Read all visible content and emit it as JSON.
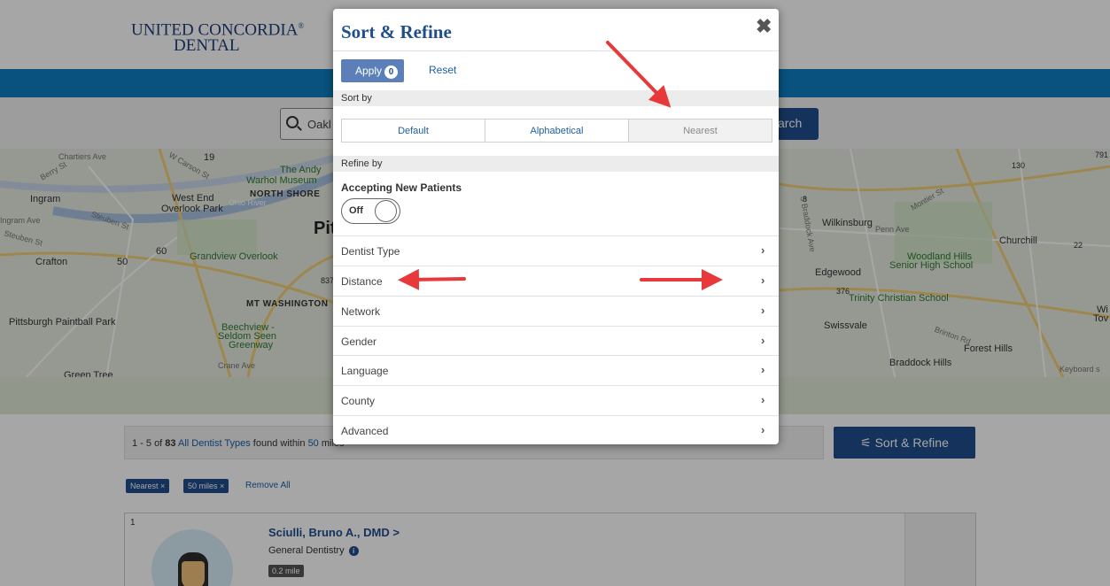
{
  "header": {
    "logo_line1": "UNITED CONCORDIA",
    "logo_reg": "®",
    "logo_line2": "DENTAL"
  },
  "search": {
    "value": "Oakl",
    "button_label": "arch"
  },
  "map": {
    "labels": {
      "ingram": "Ingram",
      "west_end": "West End",
      "overlook_park": "Overlook Park",
      "andy_warhol": "The Andy",
      "warhol_museum": "Warhol Museum",
      "north_shore": "NORTH SHORE",
      "ohio_river": "Ohio River",
      "pitt_partial": "Pit",
      "grandview": "Grandview Overlook",
      "crafton": "Crafton",
      "mt_washington": "MT WASHINGTON",
      "pittsburgh_paintball": "Pittsburgh Paintball Park",
      "beechview": "Beechview -",
      "seldom_seen": "Seldom Seen",
      "greenway": "Greenway",
      "crane_ave": "Crane Ave",
      "green_tree": "Green Tree",
      "chartiers_ave": "Chartiers Ave",
      "berry_st": "Berry St",
      "w_carson": "W Carson St",
      "steuben": "Steuben St",
      "steuben2": "Steuben St",
      "ingram_ave": "Ingram Ave",
      "wilkinsburg": "Wilkinsburg",
      "churchill": "Churchill",
      "woodland_hills": "Woodland Hills",
      "senior_high": "Senior High School",
      "edgewood": "Edgewood",
      "trinity": "Trinity Christian School",
      "swissvale": "Swissvale",
      "forest_hills": "Forest Hills",
      "braddock_hills": "Braddock Hills",
      "keyboard": "Keyboard s",
      "wi_partial": "Wi",
      "tov_partial": "Tov",
      "penn_ave": "Penn Ave",
      "braddock_ave": "S Braddock Ave",
      "brinton": "Brinton Rd",
      "monroe": "Montier St",
      "route_19": "19",
      "route_60": "60",
      "route_50": "50",
      "route_837": "837",
      "route_376": "376",
      "route_130": "130",
      "route_791": "791",
      "route_8": "8",
      "route_22": "22"
    }
  },
  "results": {
    "prefix": "1 - 5 of ",
    "count": "83",
    "type_link": "All Dentist Types",
    "middle": " found within ",
    "radius": "50",
    "suffix": " miles"
  },
  "sort_refine_button": "Sort & Refine",
  "chips": [
    "Nearest ×",
    "50 miles ×"
  ],
  "remove_all": "Remove All",
  "card": {
    "index": "1",
    "name": "Sciulli, Bruno A., DMD",
    "specialty": "General Dentistry",
    "distance": "0.2 mile"
  },
  "modal": {
    "title": "Sort & Refine",
    "close": "✖",
    "apply_label": "Apply",
    "apply_count": "0",
    "reset_label": "Reset",
    "sort_by": "Sort by",
    "sort_options": [
      "Default",
      "Alphabetical",
      "Nearest"
    ],
    "refine_by": "Refine by",
    "accepting_label": "Accepting New Patients",
    "toggle_state": "Off",
    "filters": [
      "Dentist Type",
      "Distance",
      "Network",
      "Gender",
      "Language",
      "County",
      "Advanced"
    ],
    "chevron": "›"
  },
  "colors": {
    "brand_blue": "#1f4e8c",
    "band_blue": "#0d7fc1",
    "arrow_red": "#e8393a"
  }
}
